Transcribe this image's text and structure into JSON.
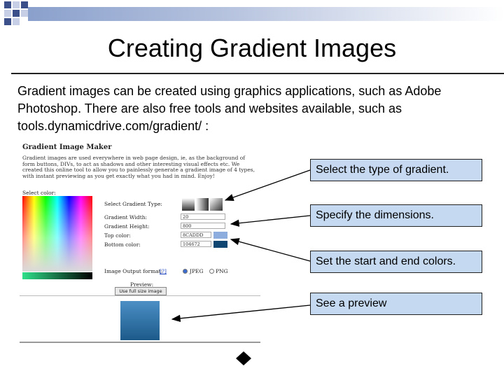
{
  "slide": {
    "title": "Creating Gradient Images",
    "body": "Gradient images can be created using graphics applications, such as Adobe Photoshop.  There are also free tools and websites available, such as tools.dynamicdrive.com/gradient/ :"
  },
  "screenshot": {
    "heading": "Gradient Image Maker",
    "description": "Gradient images are used everywhere in web page design, ie, as the background of form buttons, DIVs, to act as shadows and other interesting visual effects etc. We created this online tool to allow you to painlessly generate a gradient image of 4 types, with instant previewing as you get exactly what you had in mind. Enjoy!",
    "select_color_label": "Select color:",
    "gradient_type_label": "Select Gradient Type:",
    "width_label": "Gradient Width:",
    "width_value": "20",
    "height_label": "Gradient Height:",
    "height_value": "800",
    "top_color_label": "Top color:",
    "top_color_value": "8CADDD",
    "bottom_color_label": "Bottom color:",
    "bottom_color_value": "104672",
    "output_format_label": "Image Output format:",
    "help_link": "[?]",
    "format_jpeg": "JPEG",
    "format_png": "PNG",
    "preview_label": "Preview:",
    "full_size_button": "Use full size image",
    "top_swatch_color": "#8CADDD",
    "bottom_swatch_color": "#104672"
  },
  "callouts": [
    {
      "text": "Select the type of gradient."
    },
    {
      "text": "Specify the dimensions."
    },
    {
      "text": "Set the start and end colors."
    },
    {
      "text": "See a preview"
    }
  ],
  "colors": {
    "callout_fill": "#C5D9F1",
    "decor_square": "#3B4F8A"
  }
}
